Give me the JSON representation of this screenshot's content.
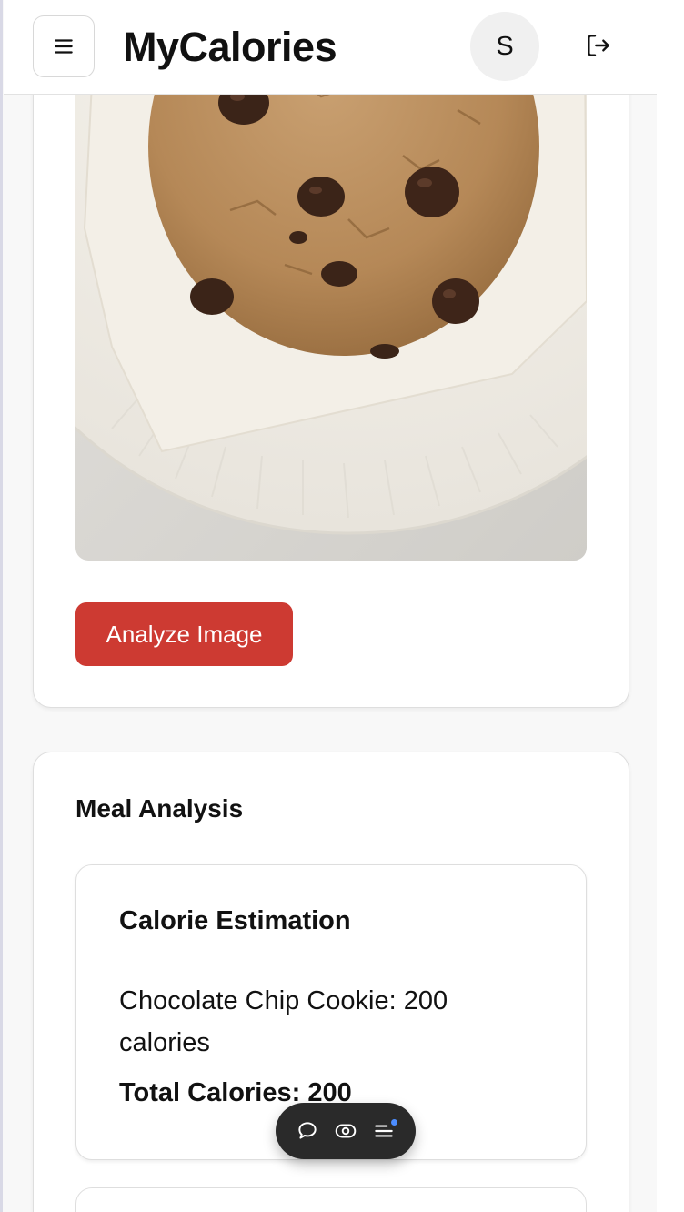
{
  "header": {
    "title": "MyCalories",
    "avatar_initial": "S",
    "menu_icon": "hamburger-menu-icon",
    "logout_icon": "logout-icon"
  },
  "upload": {
    "image_description_icon": "food-photo",
    "analyze_label": "Analyze Image"
  },
  "meal_analysis": {
    "title": "Meal Analysis",
    "calorie_card": {
      "title": "Calorie Estimation",
      "item": "Chocolate Chip Cookie: 200 calories",
      "total": "Total Calories: 200"
    }
  },
  "toolbar": {
    "icons": [
      "comment-icon",
      "eye-icon",
      "list-icon"
    ],
    "notification_color": "#4c8dff"
  },
  "colors": {
    "accent": "#cd3a32",
    "toolbar_bg": "#2a2a2a"
  }
}
